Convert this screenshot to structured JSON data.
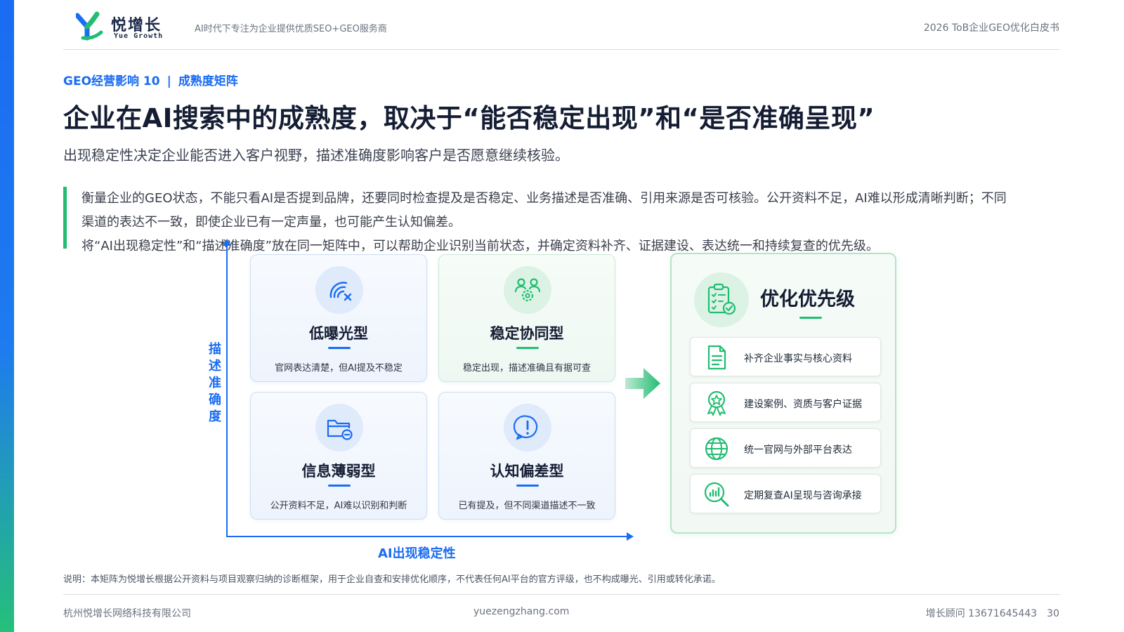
{
  "header": {
    "logo_cn": "悦增长",
    "logo_en": "Yue Growth",
    "tagline": "AI时代下专注为企业提供优质SEO+GEO服务商",
    "doc_title": "2026 ToB企业GEO优化白皮书"
  },
  "section": {
    "tag": "GEO经营影响 10",
    "separator": "|",
    "topic": "成熟度矩阵"
  },
  "title": "企业在AI搜索中的成熟度，取决于“能否稳定出现”和“是否准确呈现”",
  "subtitle": "出现稳定性决定企业能否进入客户视野，描述准确度影响客户是否愿意继续核验。",
  "quote": {
    "p1": "衡量企业的GEO状态，不能只看AI是否提到品牌，还要同时检查提及是否稳定、业务描述是否准确、引用来源是否可核验。公开资料不足，AI难以形成清晰判断；不同渠道的表达不一致，即使企业已有一定声量，也可能产生认知偏差。",
    "p2": "将“AI出现稳定性”和“描述准确度”放在同一矩阵中，可以帮助企业识别当前状态，并确定资料补齐、证据建设、表达统一和持续复查的优先级。"
  },
  "matrix": {
    "y_axis_label": "描述准确度",
    "x_axis_label": "AI出现稳定性",
    "quadrants": [
      {
        "title": "低曝光型",
        "desc": "官网表达清楚，但AI提及不稳定",
        "icon": "signal-off-icon"
      },
      {
        "title": "稳定协同型",
        "desc": "稳定出现，描述准确且有据可查",
        "icon": "team-gear-icon"
      },
      {
        "title": "信息薄弱型",
        "desc": "公开资料不足，AI难以识别和判断",
        "icon": "folder-minus-icon"
      },
      {
        "title": "认知偏差型",
        "desc": "已有提及，但不同渠道描述不一致",
        "icon": "alert-icon"
      }
    ]
  },
  "priority": {
    "title": "优化优先级",
    "items": [
      {
        "label": "补齐企业事实与核心资料",
        "icon": "document-icon"
      },
      {
        "label": "建设案例、资质与客户证据",
        "icon": "award-icon"
      },
      {
        "label": "统一官网与外部平台表达",
        "icon": "globe-icon"
      },
      {
        "label": "定期复查AI呈现与咨询承接",
        "icon": "chart-search-icon"
      }
    ]
  },
  "note": "说明：本矩阵为悦增长根据公开资料与项目观察归纳的诊断框架，用于企业自查和安排优化顺序，不代表任何AI平台的官方评级，也不构成曝光、引用或转化承诺。",
  "footer": {
    "company": "杭州悦增长网络科技有限公司",
    "website": "yuezengzhang.com",
    "contact": "增长顾问 13671645443",
    "page": "30"
  },
  "colors": {
    "primary_blue": "#1a6cf2",
    "accent_green": "#22bd72",
    "title_dark": "#141d33"
  }
}
